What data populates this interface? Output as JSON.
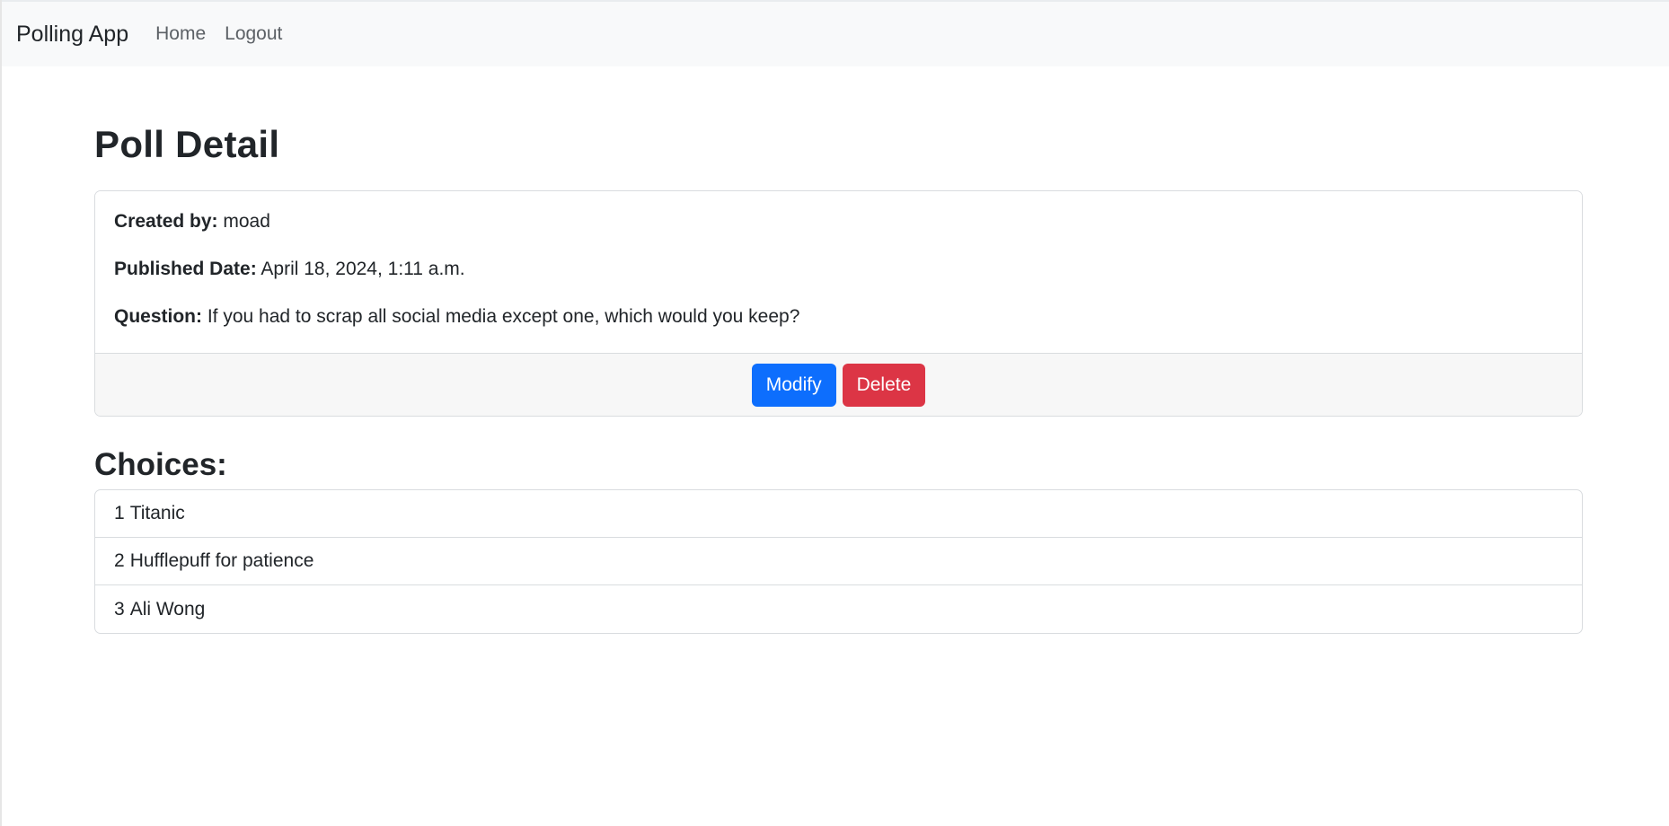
{
  "nav": {
    "brand": "Polling App",
    "links": [
      "Home",
      "Logout"
    ]
  },
  "page": {
    "title": "Poll Detail"
  },
  "poll": {
    "created_by_label": "Created by:",
    "created_by": "moad",
    "published_label": "Published Date:",
    "published": "April 18, 2024, 1:11 a.m.",
    "question_label": "Question:",
    "question": "If you had to scrap all social media except one, which would you keep?"
  },
  "actions": {
    "modify": "Modify",
    "delete": "Delete"
  },
  "choices": {
    "title": "Choices:",
    "items": [
      {
        "num": "1",
        "text": "Titanic"
      },
      {
        "num": "2",
        "text": "Hufflepuff for patience"
      },
      {
        "num": "3",
        "text": "Ali Wong"
      }
    ]
  },
  "colors": {
    "primary": "#0d6efd",
    "danger": "#dc3545",
    "navbar_bg": "#f8f9fa"
  }
}
